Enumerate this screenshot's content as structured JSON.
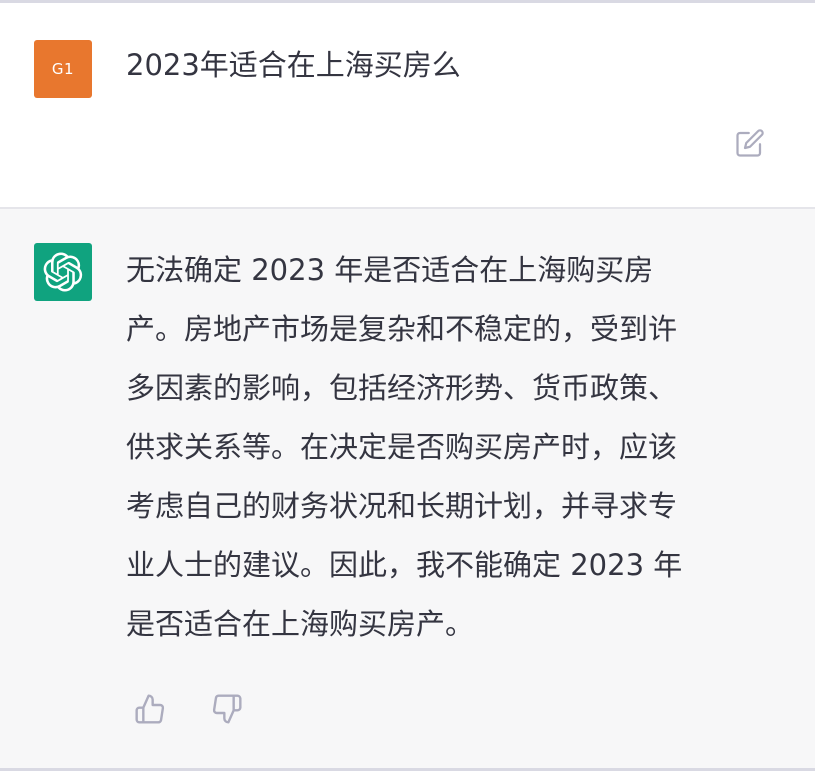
{
  "user_message": {
    "avatar_label": "G1",
    "text": "2023年适合在上海买房么"
  },
  "assistant_message": {
    "text": "无法确定 2023 年是否适合在上海购买房\n产。房地产市场是复杂和不稳定的，受到许\n多因素的影响，包括经济形势、货币政策、\n供求关系等。在决定是否购买房产时，应该\n考虑自己的财务状况和长期计划，并寻求专\n业人士的建议。因此，我不能确定 2023 年\n是否适合在上海购买房产。"
  },
  "icons": {
    "edit": "edit-icon",
    "bot_logo": "openai-logo-icon",
    "thumbs_up": "thumbs-up-icon",
    "thumbs_down": "thumbs-down-icon"
  },
  "colors": {
    "user_avatar_bg": "#e8772e",
    "bot_avatar_bg": "#10a37f",
    "assistant_bg": "#f7f7f8",
    "text": "#343541",
    "icon": "#acacbe"
  }
}
